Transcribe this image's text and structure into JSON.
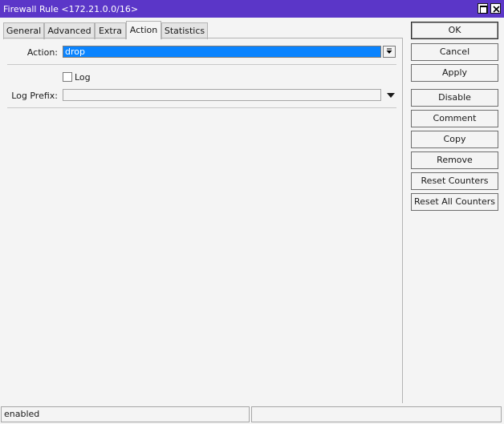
{
  "window": {
    "title": "Firewall Rule <172.21.0.0/16>"
  },
  "tabs": [
    {
      "label": "General"
    },
    {
      "label": "Advanced"
    },
    {
      "label": "Extra"
    },
    {
      "label": "Action"
    },
    {
      "label": "Statistics"
    }
  ],
  "active_tab": "Action",
  "form": {
    "action_label": "Action:",
    "action_value": "drop",
    "log_label": "Log",
    "log_checked": false,
    "log_prefix_label": "Log Prefix:",
    "log_prefix_value": ""
  },
  "buttons": {
    "ok": "OK",
    "cancel": "Cancel",
    "apply": "Apply",
    "disable": "Disable",
    "comment": "Comment",
    "copy": "Copy",
    "remove": "Remove",
    "reset_counters": "Reset Counters",
    "reset_all_counters": "Reset All Counters"
  },
  "status": {
    "state": "enabled",
    "secondary": ""
  },
  "colors": {
    "titlebar": "#5b36c8",
    "selection": "#0a84ff",
    "background": "#f4f4f4"
  }
}
